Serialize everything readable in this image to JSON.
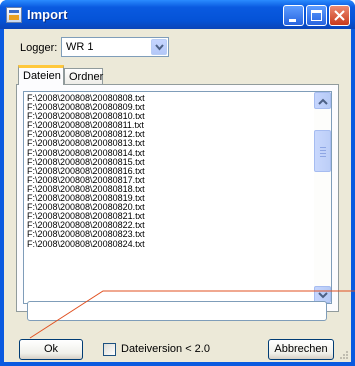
{
  "window": {
    "title": "Import",
    "colors": {
      "titlebar": "#0a5ae0",
      "client": "#ece9d8",
      "annotation_line": "#e05020"
    }
  },
  "logger": {
    "label": "Logger:",
    "selected": "WR 1"
  },
  "tabs": [
    {
      "label": "Dateien",
      "active": true
    },
    {
      "label": "Ordner",
      "active": false
    }
  ],
  "files": [
    "F:\\2008\\200808\\20080808.txt",
    "F:\\2008\\200808\\20080809.txt",
    "F:\\2008\\200808\\20080810.txt",
    "F:\\2008\\200808\\20080811.txt",
    "F:\\2008\\200808\\20080812.txt",
    "F:\\2008\\200808\\20080813.txt",
    "F:\\2008\\200808\\20080814.txt",
    "F:\\2008\\200808\\20080815.txt",
    "F:\\2008\\200808\\20080816.txt",
    "F:\\2008\\200808\\20080817.txt",
    "F:\\2008\\200808\\20080818.txt",
    "F:\\2008\\200808\\20080819.txt",
    "F:\\2008\\200808\\20080820.txt",
    "F:\\2008\\200808\\20080821.txt",
    "F:\\2008\\200808\\20080822.txt",
    "F:\\2008\\200808\\20080823.txt",
    "F:\\2008\\200808\\20080824.txt"
  ],
  "path_field": {
    "value": ""
  },
  "buttons": {
    "ok": "Ok",
    "cancel": "Abbrechen"
  },
  "checkbox": {
    "label": "Dateiversion < 2.0",
    "checked": false
  },
  "icons": {
    "app": "import-window-icon",
    "minimize": "minimize-icon",
    "maximize": "maximize-icon",
    "close": "close-icon",
    "dropdown": "chevron-down-icon",
    "scroll_up": "scroll-up-arrow-icon",
    "scroll_down": "scroll-down-arrow-icon"
  }
}
